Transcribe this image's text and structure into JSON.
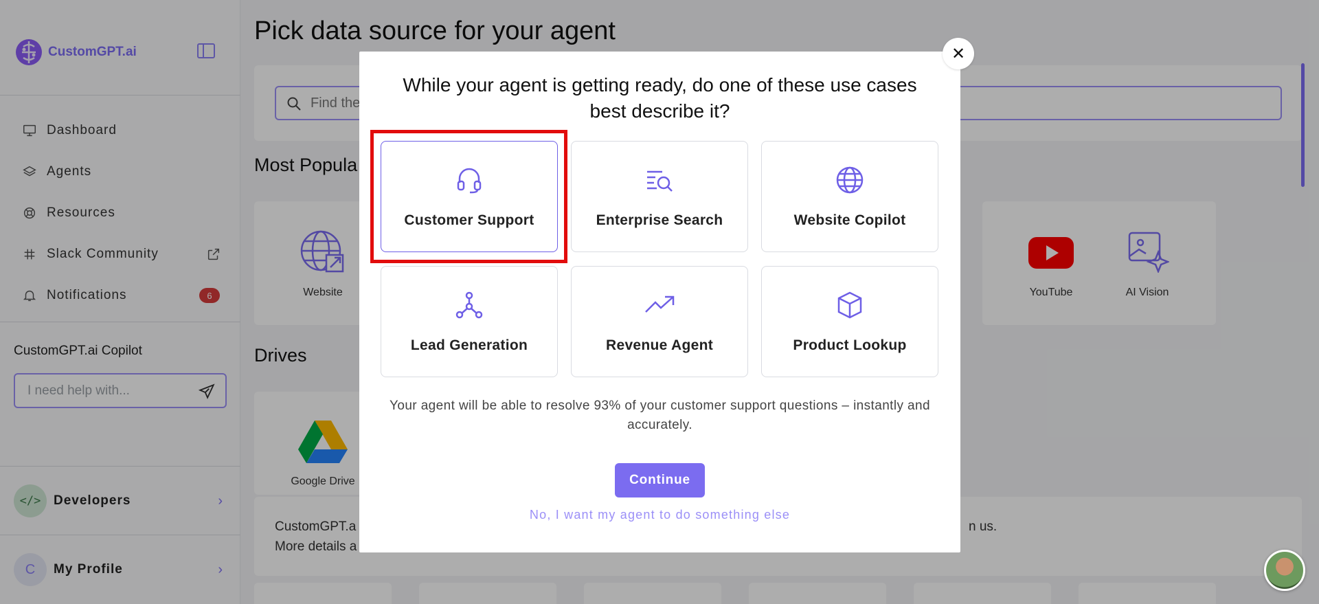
{
  "brand": {
    "name": "CustomGPT.ai",
    "accent": "#7b6cf0"
  },
  "sidebar": {
    "nav": [
      {
        "label": "Dashboard",
        "icon": "monitor-icon"
      },
      {
        "label": "Agents",
        "icon": "layers-icon"
      },
      {
        "label": "Resources",
        "icon": "lifebuoy-icon"
      },
      {
        "label": "Slack Community",
        "icon": "slack-icon"
      },
      {
        "label": "Notifications",
        "icon": "bell-icon",
        "badge": "6"
      }
    ],
    "copilot": {
      "title": "CustomGPT.ai Copilot",
      "placeholder": "I need help with..."
    },
    "developers": {
      "label": "Developers",
      "icon_text": "</>"
    },
    "profile": {
      "label": "My Profile",
      "initial": "C"
    }
  },
  "main": {
    "title": "Pick data source for your agent",
    "search_placeholder": "Find the",
    "popular_title": "Most Popula",
    "sources": [
      {
        "label": "Website"
      },
      {
        "label": "YouTube"
      },
      {
        "label": "AI Vision"
      }
    ],
    "drives_title": "Drives",
    "drive": {
      "label": "Google Drive"
    },
    "info": {
      "line1": "CustomGPT.a",
      "line2": "More details a",
      "line1_tail": "n us."
    }
  },
  "modal": {
    "title": "While your agent is getting ready, do one of these use cases best describe it?",
    "close_symbol": "✕",
    "use_cases": [
      {
        "label": "Customer Support",
        "icon": "headset-icon",
        "selected": true
      },
      {
        "label": "Enterprise Search",
        "icon": "search-list-icon"
      },
      {
        "label": "Website Copilot",
        "icon": "globe-icon"
      },
      {
        "label": "Lead Generation",
        "icon": "network-icon"
      },
      {
        "label": "Revenue Agent",
        "icon": "trending-up-icon"
      },
      {
        "label": "Product Lookup",
        "icon": "box-icon"
      }
    ],
    "description": "Your agent will be able to resolve 93% of your customer support questions – instantly and accurately.",
    "continue_label": "Continue",
    "else_label": "No, I want my agent to do something else"
  }
}
